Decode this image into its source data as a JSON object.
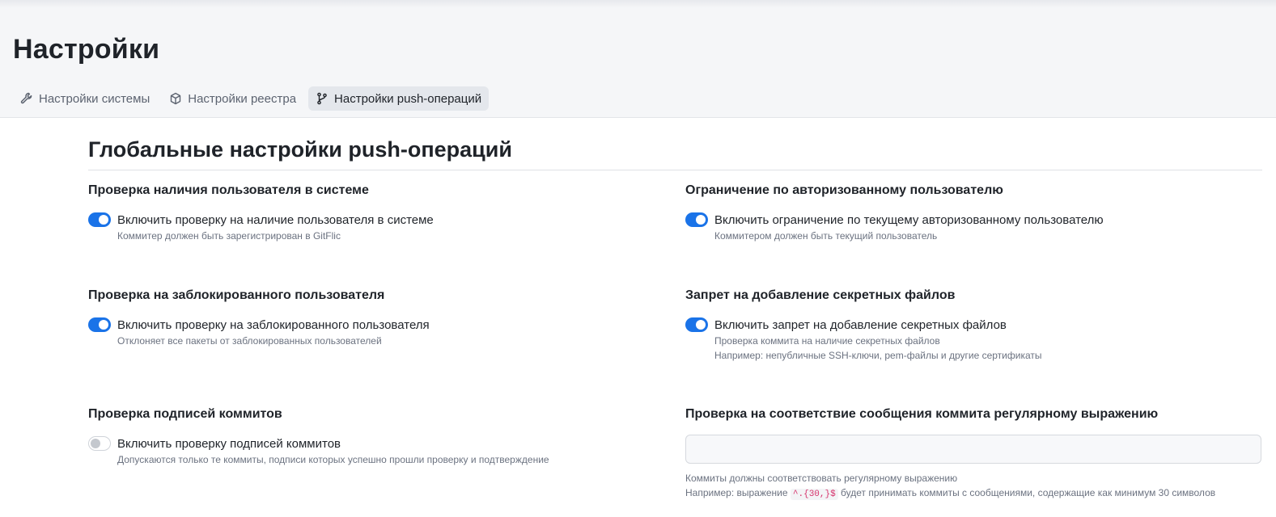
{
  "header": {
    "title": "Настройки",
    "tabs": [
      {
        "label": "Настройки системы",
        "icon": "wrench-icon",
        "active": false
      },
      {
        "label": "Настройки реестра",
        "icon": "package-icon",
        "active": false
      },
      {
        "label": "Настройки push-операций",
        "icon": "git-branch-icon",
        "active": true
      }
    ]
  },
  "section": {
    "title": "Глобальные настройки push-операций"
  },
  "settings": {
    "user_exists": {
      "title": "Проверка наличия пользователя в системе",
      "toggle_label": "Включить проверку на наличие пользователя в системе",
      "enabled": true,
      "hints": [
        "Коммитер должен быть зарегистрирован в GitFlic"
      ]
    },
    "authorized_user": {
      "title": "Ограничение по авторизованному пользователю",
      "toggle_label": "Включить ограничение по текущему авторизованному пользователю",
      "enabled": true,
      "hints": [
        "Коммитером должен быть текущий пользователь"
      ]
    },
    "blocked_user": {
      "title": "Проверка на заблокированного пользователя",
      "toggle_label": "Включить проверку на заблокированного пользователя",
      "enabled": true,
      "hints": [
        "Отклоняет все пакеты от заблокированных пользователей"
      ]
    },
    "secret_files": {
      "title": "Запрет на добавление секретных файлов",
      "toggle_label": "Включить запрет на добавление секретных файлов",
      "enabled": true,
      "hints": [
        "Проверка коммита на наличие секретных файлов",
        "Например: непубличные SSH-ключи, pem-файлы и другие сертификаты"
      ]
    },
    "commit_signatures": {
      "title": "Проверка подписей коммитов",
      "toggle_label": "Включить проверку подписей коммитов",
      "enabled": false,
      "hints": [
        "Допускаются только те коммиты, подписи которых успешно прошли проверку и подтверждение"
      ]
    },
    "commit_message_regex": {
      "title": "Проверка на соответствие сообщения коммита регулярному выражению",
      "value": "",
      "hint_1": "Коммиты должны соответствовать регулярному выражению",
      "hint_2_prefix": "Например: выражение",
      "hint_2_code": "^.{30,}$",
      "hint_2_suffix": "будет принимать коммиты с сообщениями, содержащие как минимум 30 символов"
    }
  },
  "colors": {
    "toggle_on": "#1a73e8",
    "regex_code": "#d6336c"
  }
}
